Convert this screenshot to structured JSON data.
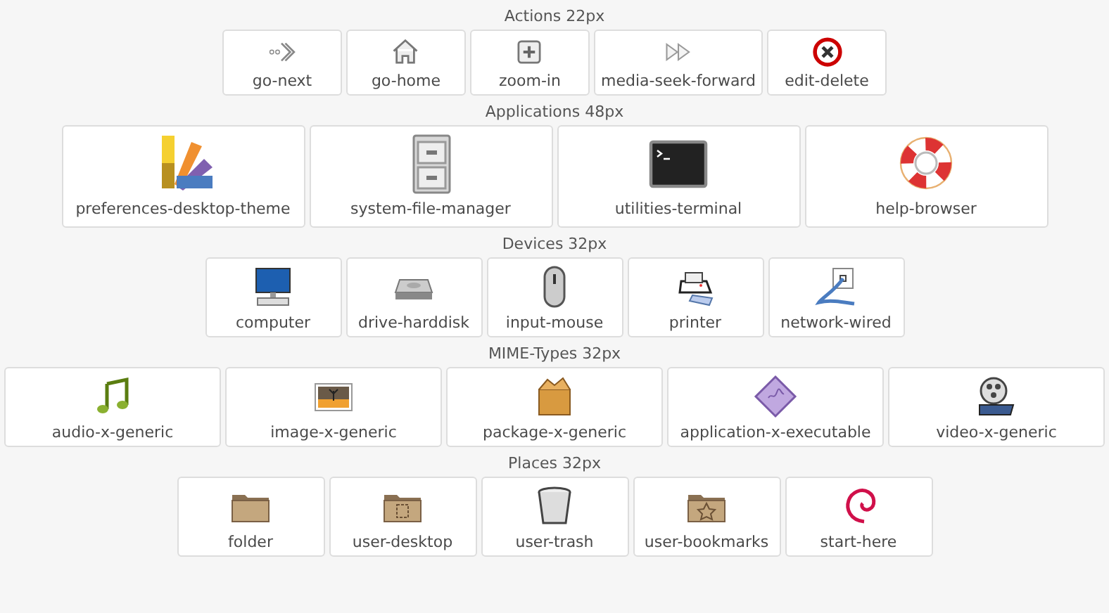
{
  "sections": [
    {
      "title": "Actions 22px",
      "items": [
        {
          "label": "go-next"
        },
        {
          "label": "go-home"
        },
        {
          "label": "zoom-in"
        },
        {
          "label": "media-seek-forward"
        },
        {
          "label": "edit-delete"
        }
      ]
    },
    {
      "title": "Applications 48px",
      "items": [
        {
          "label": "preferences-desktop-theme"
        },
        {
          "label": "system-file-manager"
        },
        {
          "label": "utilities-terminal"
        },
        {
          "label": "help-browser"
        }
      ]
    },
    {
      "title": "Devices 32px",
      "items": [
        {
          "label": "computer"
        },
        {
          "label": "drive-harddisk"
        },
        {
          "label": "input-mouse"
        },
        {
          "label": "printer"
        },
        {
          "label": "network-wired"
        }
      ]
    },
    {
      "title": "MIME-Types 32px",
      "items": [
        {
          "label": "audio-x-generic"
        },
        {
          "label": "image-x-generic"
        },
        {
          "label": "package-x-generic"
        },
        {
          "label": "application-x-executable"
        },
        {
          "label": "video-x-generic"
        }
      ]
    },
    {
      "title": "Places 32px",
      "items": [
        {
          "label": "folder"
        },
        {
          "label": "user-desktop"
        },
        {
          "label": "user-trash"
        },
        {
          "label": "user-bookmarks"
        },
        {
          "label": "start-here"
        }
      ]
    }
  ]
}
